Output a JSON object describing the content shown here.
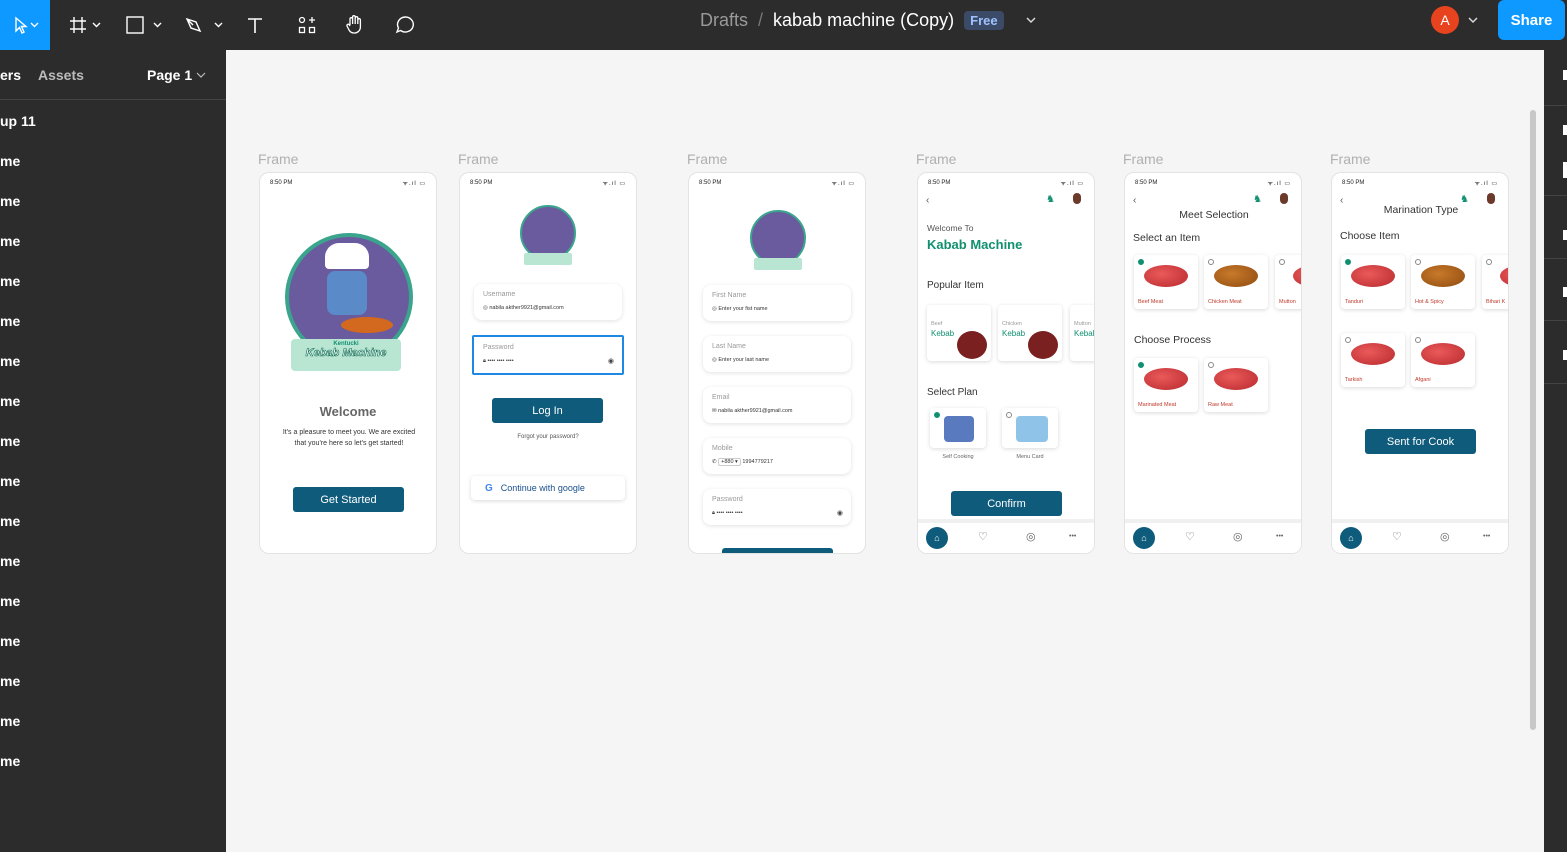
{
  "toolbar": {
    "breadcrumb": "Drafts",
    "separator": "/",
    "file_name": "kabab machine (Copy)",
    "plan_badge": "Free",
    "avatar_letter": "A",
    "share_label": "Share"
  },
  "sidebar": {
    "tab_layers": "ers",
    "tab_assets": "Assets",
    "page_selector": "Page 1",
    "layers": [
      "up 11",
      "me",
      "me",
      "me",
      "me",
      "me",
      "me",
      "me",
      "me",
      "me",
      "me",
      "me",
      "me",
      "me",
      "me",
      "me",
      "me"
    ]
  },
  "frames": {
    "label": "Frame",
    "status_time": "8:50 PM",
    "status_icons": "ᯤ.ıl ▭"
  },
  "f1": {
    "logo_top": "Kentucki",
    "logo_bottom": "Kebab Machine",
    "title": "Welcome",
    "text": "It's a pleasure to meet you. We are excited that you're here so let's get started!",
    "button": "Get Started"
  },
  "f2": {
    "username_label": "Username",
    "username_value": "nabila akther9921@gmail.com",
    "password_label": "Password",
    "password_value": "•••• •••• ••••",
    "login_button": "Log In",
    "forgot": "Forgot your password?",
    "google_button": "Continue with google"
  },
  "f3": {
    "first_label": "First Name",
    "first_placeholder": "Enter your fist name",
    "last_label": "Last Name",
    "last_placeholder": "Enter your last name",
    "email_label": "Email",
    "email_value": "nabila akther9921@gmail.com",
    "mobile_label": "Mobile",
    "country_code": "+880 ▾",
    "mobile_value": "1994779217",
    "password_label": "Password",
    "password_value": "•••• •••• ••••"
  },
  "f4": {
    "welcome": "Welcome To",
    "brand": "Kabab Machine",
    "popular": "Popular Item",
    "items": [
      {
        "a": "Beef",
        "b": "Kebab"
      },
      {
        "a": "Chicken",
        "b": "Kebab"
      },
      {
        "a": "Mutton",
        "b": "Kebal"
      }
    ],
    "select_plan": "Select Plan",
    "plans": [
      "Self Cooking",
      "Menu Card"
    ],
    "confirm": "Confirm"
  },
  "f5": {
    "title": "Meet Selection",
    "select_item": "Select an Item",
    "items": [
      "Beef Meat",
      "Chicken Meat",
      "Mutton"
    ],
    "choose_process": "Choose Process",
    "processes": [
      "Marinated Meat",
      "Raw Meat"
    ]
  },
  "f6": {
    "title": "Marination Type",
    "choose_item": "Choose Item",
    "items": [
      "Tanduri",
      "Hot & Spicy",
      "Bihari K"
    ],
    "items2": [
      "Tarkish",
      "Afgani"
    ],
    "button": "Sent for Cook"
  },
  "nav": {
    "home": "⌂",
    "heart": "♡",
    "profile": "◎",
    "more": "•••"
  },
  "colors": {
    "accent": "#0d99ff",
    "primary_button": "#0e5b7c",
    "brand_green": "#109070"
  }
}
